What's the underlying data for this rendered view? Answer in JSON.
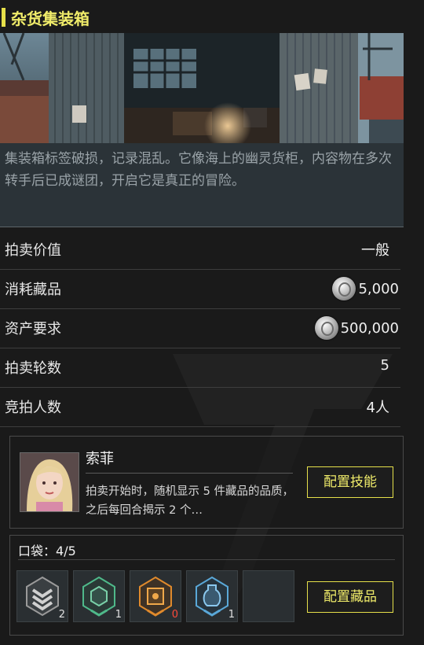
{
  "header": {
    "title": "杂货集装箱"
  },
  "hero": {
    "description": "集装箱标签破损，记录混乱。它像海上的幽灵货柜，内容物在多次转手后已成谜团，开启它是真正的冒险。"
  },
  "stats": [
    {
      "label": "拍卖价值",
      "value": "一般",
      "coin": false
    },
    {
      "label": "消耗藏品",
      "value": "5,000",
      "coin": true
    },
    {
      "label": "资产要求",
      "value": "500,000",
      "coin": true
    },
    {
      "label": "拍卖轮数",
      "value": "5",
      "coin": false
    },
    {
      "label": "竞拍人数",
      "value": "4人",
      "coin": false
    }
  ],
  "character": {
    "name": "索菲",
    "skill_description": "拍卖开始时，随机显示 5 件藏品的品质，之后每回合揭示 2 个…",
    "configure_skill_label": "配置技能"
  },
  "pocket": {
    "label": "口袋：",
    "value": "4/5",
    "slots": [
      {
        "icon": "gray-chevron-badge-icon",
        "count": "2",
        "color": "#b8b8b8"
      },
      {
        "icon": "green-hex-badge-icon",
        "count": "1",
        "color": "#4fb98a"
      },
      {
        "icon": "orange-hex-badge-icon",
        "count": "0",
        "color": "#e08a2c"
      },
      {
        "icon": "blue-vase-badge-icon",
        "count": "1",
        "color": "#5aa8d8"
      },
      {
        "icon": "empty-slot",
        "count": ""
      }
    ],
    "configure_items_label": "配置藏品"
  },
  "colors": {
    "accent": "#e6e04a",
    "zero_count": "#ff4a3a",
    "background": "#1a1a1a"
  }
}
